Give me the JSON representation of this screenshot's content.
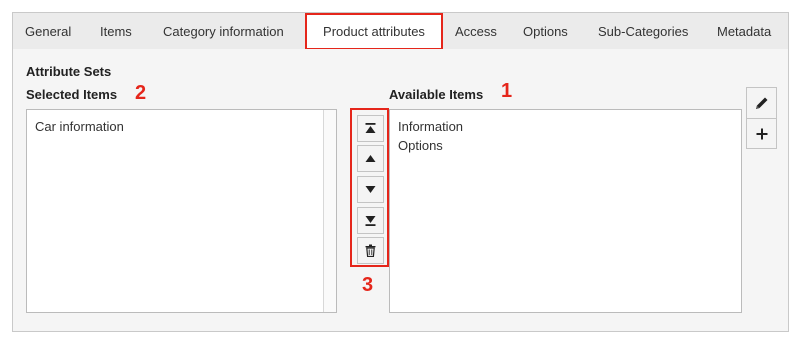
{
  "tabs": [
    {
      "label": "General"
    },
    {
      "label": "Items"
    },
    {
      "label": "Category information"
    },
    {
      "label": "Product attributes",
      "active": true
    },
    {
      "label": "Access"
    },
    {
      "label": "Options"
    },
    {
      "label": "Sub-Categories"
    },
    {
      "label": "Metadata"
    }
  ],
  "field": {
    "title": "Attribute Sets",
    "selected_label": "Selected Items",
    "available_label": "Available Items",
    "selected_items": [
      "Car information"
    ],
    "available_items": [
      "Information",
      "Options"
    ]
  },
  "callouts": {
    "selected": "2",
    "available": "1",
    "buttons": "3"
  },
  "move_buttons": [
    {
      "icon": "move-to-top-icon"
    },
    {
      "icon": "move-up-icon"
    },
    {
      "icon": "move-down-icon"
    },
    {
      "icon": "move-to-bottom-icon"
    },
    {
      "icon": "trash-icon"
    }
  ],
  "side_buttons": [
    {
      "icon": "pencil-icon"
    },
    {
      "icon": "plus-icon"
    }
  ],
  "colors": {
    "highlight": "#e5261b",
    "tab_bar": "#ebebeb",
    "panel": "#f5f5f5"
  }
}
